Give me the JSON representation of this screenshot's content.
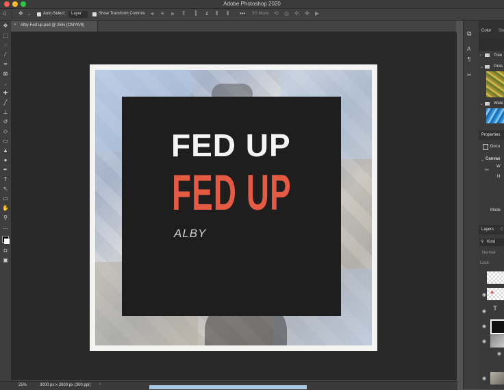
{
  "app_title": "Adobe Photoshop 2020",
  "options_bar": {
    "auto_select_label": "Auto-Select:",
    "auto_select_value": "Layer",
    "show_transform_label": "Show Transform Controls",
    "mode_3d_label": "3D Mode:"
  },
  "document_tab": "Alby-Fed up.psd @ 25% (CMYK/8)",
  "artwork": {
    "title": "FED UP",
    "title_shadow": "FED UP",
    "author": "ALBY"
  },
  "status_bar": {
    "zoom": "25%",
    "doc_info": "3000 px x 3000 px (300 ppi)"
  },
  "panels": {
    "color_tab": "Color",
    "swatches_tab": "Sw",
    "swatch_groups": [
      "Tree",
      "Gras",
      "Wate"
    ],
    "properties_title": "Properties",
    "document_label": "Docu",
    "canvas_section": "Canvas",
    "canvas_w": "W",
    "canvas_h": "H",
    "mode_label": "Mode",
    "layers_tab": "Layers",
    "layers_tab2": "C",
    "filter_kind": "Kind",
    "blend_mode": "Normal",
    "lock_label": "Lock:"
  },
  "colors": {
    "accent_red": "#e45a43",
    "inner_bg": "#1f1e1e",
    "canvas_border": "#f3f3f1"
  }
}
